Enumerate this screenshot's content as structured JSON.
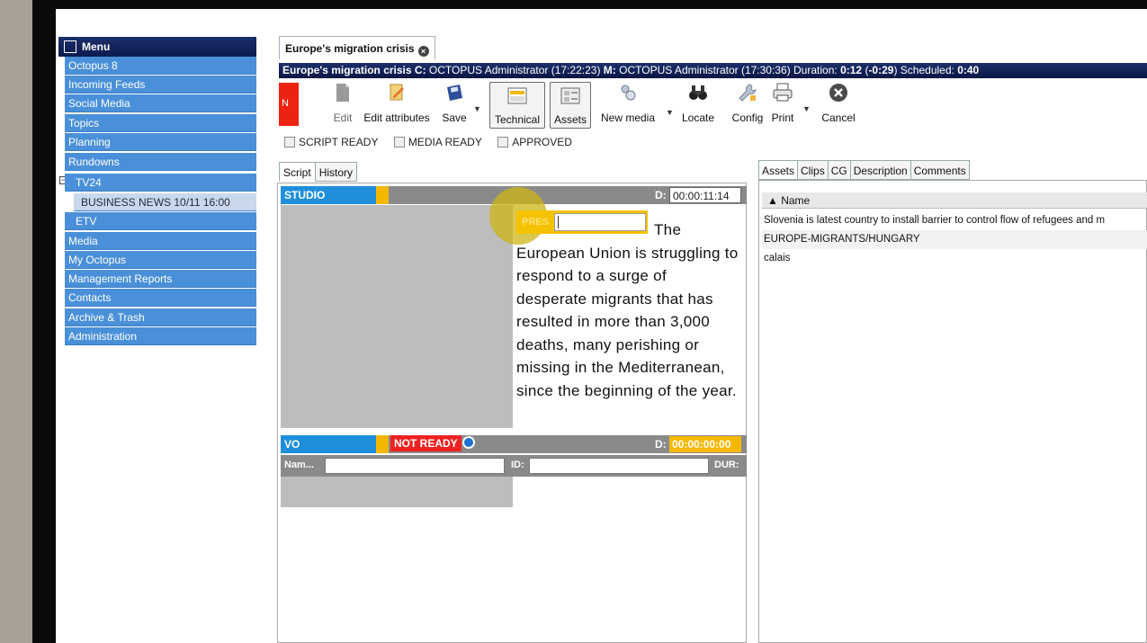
{
  "menu": {
    "header": "Menu",
    "items": [
      {
        "label": "Octopus 8"
      },
      {
        "label": "Incoming Feeds"
      },
      {
        "label": "Social Media"
      },
      {
        "label": "Topics"
      },
      {
        "label": "Planning"
      },
      {
        "label": "Rundowns"
      },
      {
        "label": "TV24"
      },
      {
        "label": "BUSINESS NEWS 10/11 16:00"
      },
      {
        "label": "ETV"
      },
      {
        "label": "Media"
      },
      {
        "label": "My Octopus"
      },
      {
        "label": "Management Reports"
      },
      {
        "label": "Contacts"
      },
      {
        "label": "Archive & Trash"
      },
      {
        "label": "Administration"
      }
    ]
  },
  "doc_tab": "Europe's migration crisis",
  "title_bar": {
    "story": "Europe's migration crisis",
    "c_label": "C:",
    "c_value": "OCTOPUS Administrator (17:22:23)",
    "m_label": "M:",
    "m_value": "OCTOPUS Administrator (17:30:36)",
    "duration_label": "Duration:",
    "duration_value": "0:12",
    "diff_value": "-0:29",
    "scheduled_label": "Scheduled:",
    "scheduled_value": "0:40"
  },
  "toolbar": {
    "status_letter": "N",
    "edit": "Edit",
    "edit_attributes": "Edit attributes",
    "save": "Save",
    "technical": "Technical",
    "assets": "Assets",
    "new_media": "New media",
    "locate": "Locate",
    "config": "Config",
    "print": "Print",
    "cancel": "Cancel"
  },
  "checkboxes": {
    "script_ready": "SCRIPT READY",
    "media_ready": "MEDIA READY",
    "approved": "APPROVED"
  },
  "script_tabs": [
    "Script",
    "History"
  ],
  "segments": {
    "studio": {
      "label": "STUDIO",
      "dur_label": "D:",
      "duration": "00:00:11:14"
    },
    "pres_tag": "PRES",
    "script_text": "The European Union is struggling to respond to a surge of desperate migrants that has resulted in more than 3,000 deaths, many perishing or missing in the Mediterranean, since the beginning of the year.",
    "vo": {
      "label": "VO",
      "status": "NOT READY",
      "dur_label": "D:",
      "duration": "00:00:00:00",
      "name_label": "Nam...",
      "id_label": "ID:",
      "dur_field_label": "DUR:"
    }
  },
  "right_tabs": [
    "Assets",
    "Clips",
    "CG",
    "Description",
    "Comments"
  ],
  "assets": {
    "column": "Name",
    "rows": [
      "Slovenia is latest country to install barrier to control flow of refugees and m",
      "EUROPE-MIGRANTS/HUNGARY",
      "calais"
    ]
  },
  "colors": {
    "menu_blue": "#4a90d9",
    "title_navy": "#0d1b4d",
    "studio_blue": "#1f8fdc",
    "accent_yellow": "#f5b800",
    "not_ready_red": "#ee2222"
  }
}
